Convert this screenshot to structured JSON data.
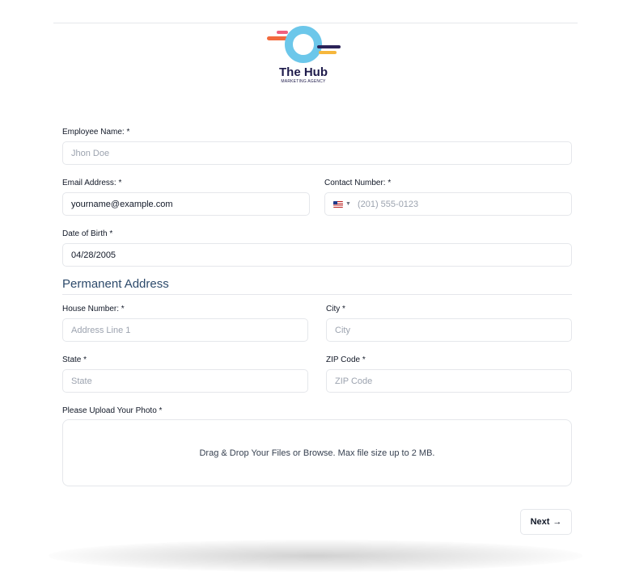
{
  "brand": {
    "name": "The Hub",
    "tagline": "MARKETING AGENCY",
    "colors": {
      "ring": "#6cc7ea",
      "orange": "#f26a3d",
      "yellow": "#f6b73c",
      "navy": "#2b2358",
      "pink": "#f0607e"
    }
  },
  "form": {
    "employee_name": {
      "label": "Employee Name: *",
      "placeholder": "Jhon Doe"
    },
    "email": {
      "label": "Email Address: *",
      "value": "yourname@example.com"
    },
    "contact": {
      "label": "Contact Number: *",
      "country_icon": "us-flag-icon",
      "placeholder": "(201) 555-0123"
    },
    "dob": {
      "label": "Date of Birth *",
      "value": "04/28/2005"
    },
    "address_section_title": "Permanent Address",
    "house_number": {
      "label": "House Number: *",
      "placeholder": "Address Line 1"
    },
    "city": {
      "label": "City *",
      "placeholder": "City"
    },
    "state": {
      "label": "State *",
      "placeholder": "State"
    },
    "zip": {
      "label": "ZIP Code *",
      "placeholder": "ZIP Code"
    },
    "photo": {
      "label": "Please Upload Your Photo *",
      "dropzone_text": "Drag & Drop Your Files or Browse. Max file size up to 2 MB."
    },
    "next_button": {
      "label": "Next",
      "arrow": "→"
    }
  }
}
